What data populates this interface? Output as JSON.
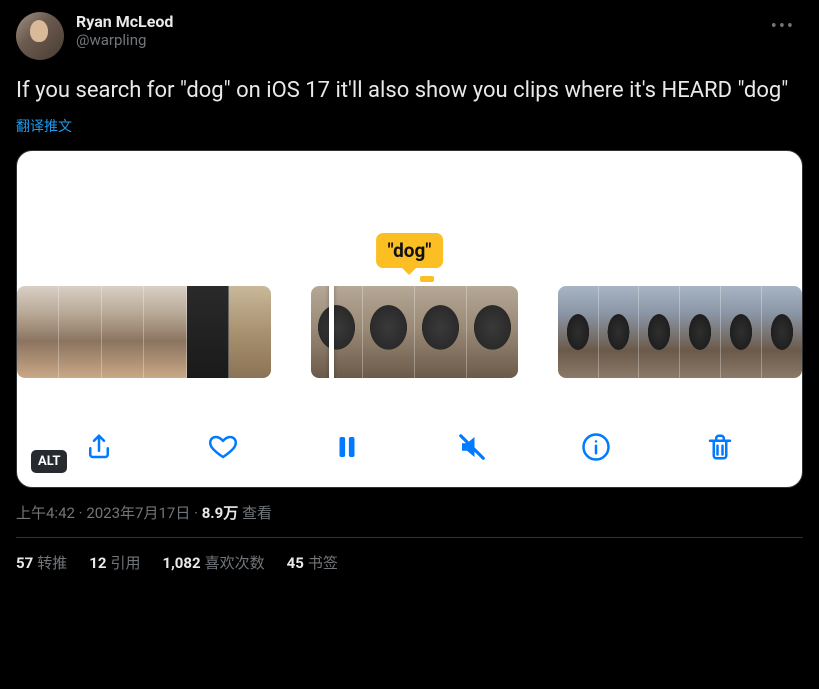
{
  "author": {
    "display_name": "Ryan McLeod",
    "handle": "@warpling"
  },
  "tweet_text": "If you search for \"dog\" on iOS 17 it'll also show you clips where it's HEARD \"dog\"",
  "translate_label": "翻译推文",
  "media": {
    "tooltip": "\"dog\"",
    "alt_badge": "ALT"
  },
  "meta": {
    "time": "上午4:42",
    "dot": " · ",
    "date": "2023年7月17日",
    "views_number": "8.9万",
    "views_label": " 查看"
  },
  "stats": {
    "retweets": {
      "count": "57",
      "label": "转推"
    },
    "quotes": {
      "count": "12",
      "label": "引用"
    },
    "likes": {
      "count": "1,082",
      "label": "喜欢次数"
    },
    "bookmarks": {
      "count": "45",
      "label": "书签"
    }
  }
}
